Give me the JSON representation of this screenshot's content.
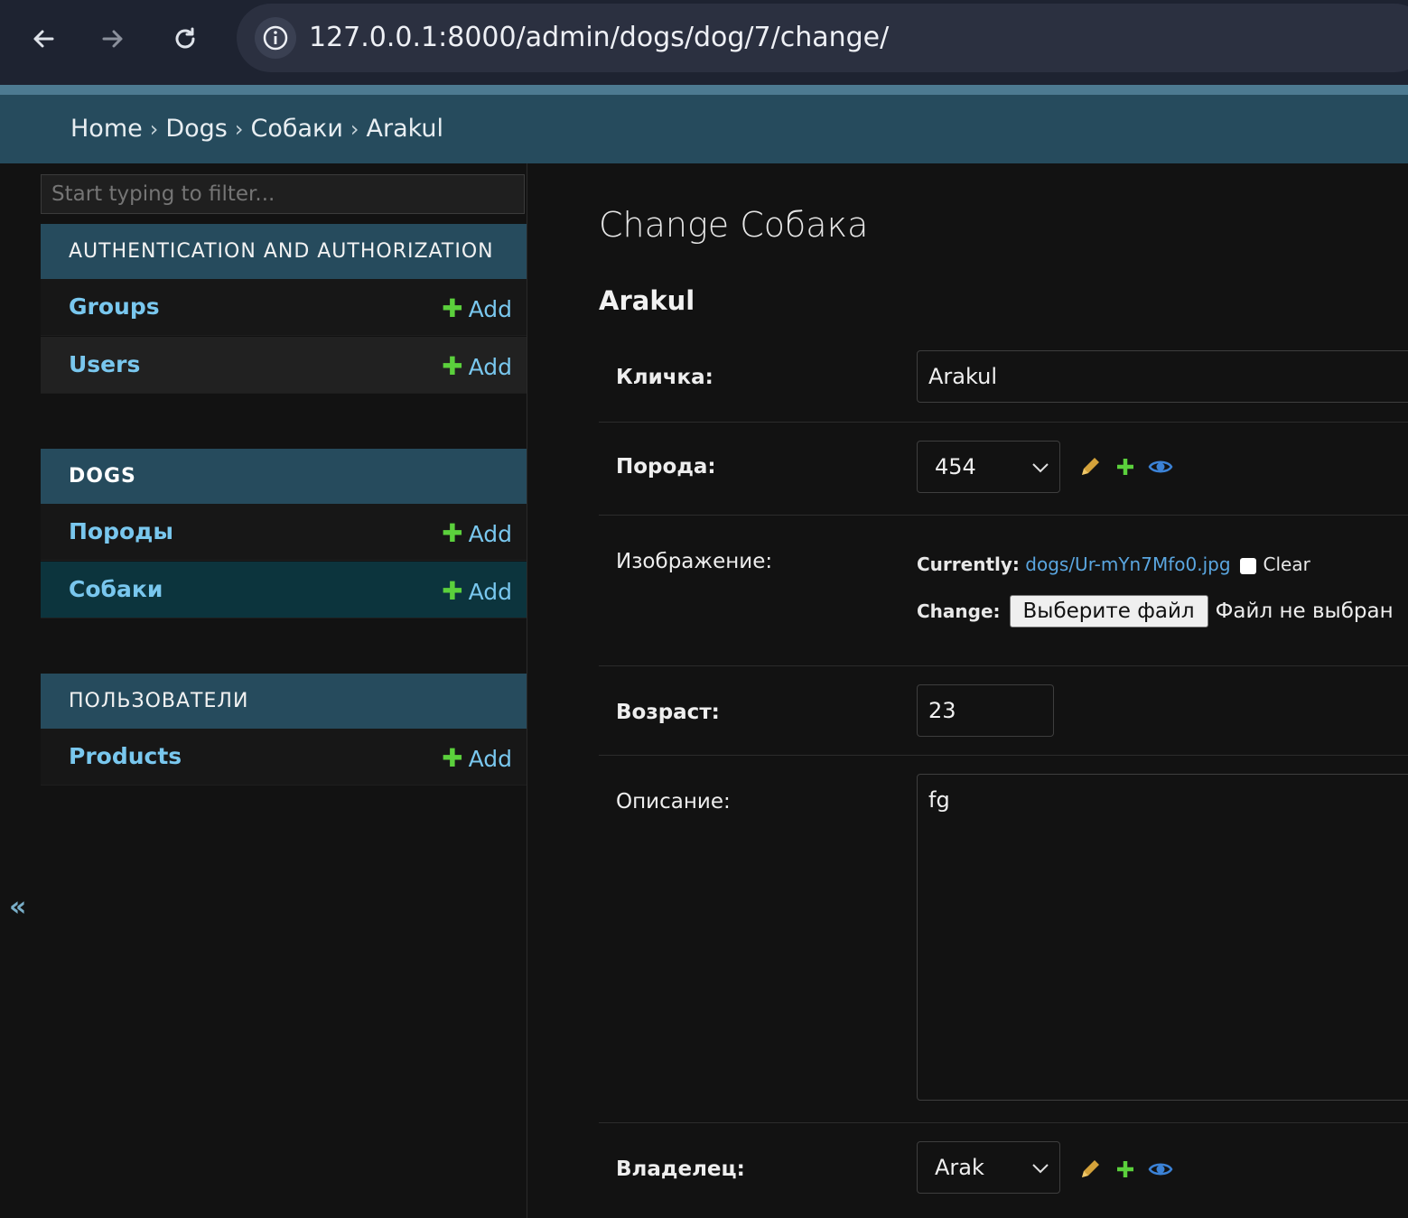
{
  "browser": {
    "url": "127.0.0.1:8000/admin/dogs/dog/7/change/",
    "info_icon": "info-icon"
  },
  "breadcrumbs": [
    "Home",
    "Dogs",
    "Собаки",
    "Arakul"
  ],
  "breadcrumb_separator": "›",
  "sidebar": {
    "filter_placeholder": "Start typing to filter...",
    "collapse_label": "«",
    "sections": [
      {
        "title": "AUTHENTICATION AND AUTHORIZATION",
        "models": [
          {
            "name": "Groups",
            "add": "Add"
          },
          {
            "name": "Users",
            "add": "Add"
          }
        ]
      },
      {
        "title": "DOGS",
        "models": [
          {
            "name": "Породы",
            "add": "Add"
          },
          {
            "name": "Собаки",
            "add": "Add",
            "active": true
          }
        ]
      },
      {
        "title": "ПОЛЬЗОВАТЕЛИ",
        "models": [
          {
            "name": "Products",
            "add": "Add"
          }
        ]
      }
    ]
  },
  "main": {
    "title": "Change Собака",
    "object_name": "Arakul",
    "fields": {
      "name": {
        "label": "Кличка:",
        "value": "Arakul"
      },
      "breed": {
        "label": "Порода:",
        "value": "454"
      },
      "image": {
        "label": "Изображение:",
        "currently_label": "Currently:",
        "current_file": "dogs/Ur-mYn7Mfo0.jpg",
        "clear_label": "Clear",
        "change_label": "Change:",
        "choose_button": "Выберите файл",
        "no_file": "Файл не выбран"
      },
      "age": {
        "label": "Возраст:",
        "value": "23"
      },
      "description": {
        "label": "Описание:",
        "value": "fg"
      },
      "owner": {
        "label": "Владелец:",
        "value": "Arak"
      }
    }
  },
  "colors": {
    "header": "#264b5d",
    "link": "#79c7ee",
    "add_plus": "#5bd03c",
    "edit_icon": "#d4a23a",
    "view_icon": "#3b82d6",
    "active_row": "#0c343d"
  }
}
